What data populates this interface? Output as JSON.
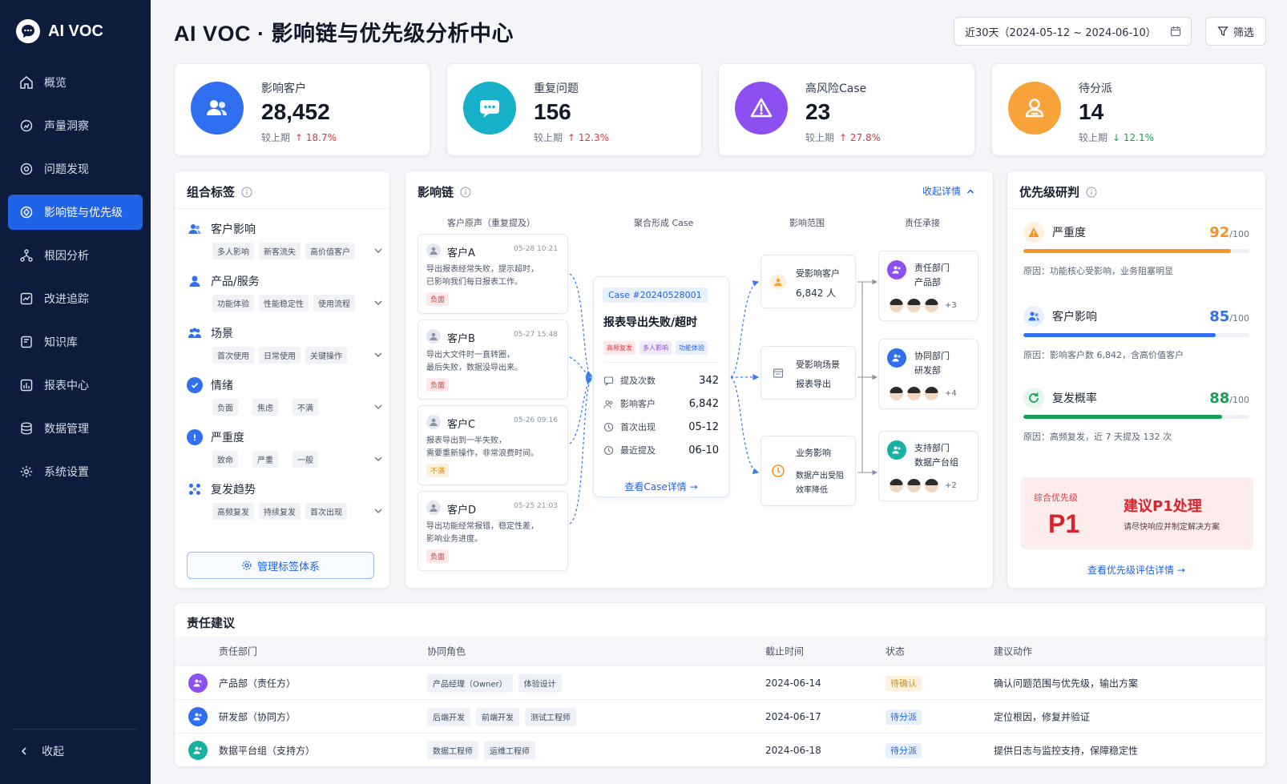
{
  "app": {
    "name": "AI VOC"
  },
  "nav": [
    {
      "label": "概览",
      "icon": "home-icon"
    },
    {
      "label": "声量洞察",
      "icon": "insight-icon"
    },
    {
      "label": "问题发现",
      "icon": "target-icon"
    },
    {
      "label": "影响链与优先级",
      "icon": "chain-icon",
      "active": true
    },
    {
      "label": "根因分析",
      "icon": "tree-icon"
    },
    {
      "label": "改进追踪",
      "icon": "track-icon"
    },
    {
      "label": "知识库",
      "icon": "book-icon"
    },
    {
      "label": "报表中心",
      "icon": "report-icon"
    },
    {
      "label": "数据管理",
      "icon": "database-icon"
    },
    {
      "label": "系统设置",
      "icon": "gear-icon"
    }
  ],
  "collapse_label": "收起",
  "page_title": "AI VOC · 影响链与优先级分析中心",
  "date_range": "近30天（2024-05-12 ~ 2024-06-10）",
  "filter_label": "筛选",
  "kpis": [
    {
      "label": "影响客户",
      "value": "28,452",
      "cmp": "较上期",
      "change": "↑ 18.7%",
      "color": "#2f6ff0"
    },
    {
      "label": "重复问题",
      "value": "156",
      "cmp": "较上期",
      "change": "↑ 12.3%",
      "color": "#16b1c8"
    },
    {
      "label": "高风险Case",
      "value": "23",
      "cmp": "较上期",
      "change": "↑ 27.8%",
      "color": "#8e4ff0"
    },
    {
      "label": "待分派",
      "value": "14",
      "cmp": "较上期",
      "change": "↓ 12.1%",
      "color": "#f7a33a"
    }
  ],
  "tags_panel": {
    "title": "组合标签",
    "groups": [
      {
        "label": "客户影响",
        "tags": [
          "多人影响",
          "新客流失",
          "高价值客户"
        ],
        "color": "#2f6ff0"
      },
      {
        "label": "产品/服务",
        "tags": [
          "功能体验",
          "性能稳定性",
          "使用流程"
        ],
        "color": "#2f6ff0"
      },
      {
        "label": "场景",
        "tags": [
          "首次使用",
          "日常使用",
          "关键操作"
        ],
        "color": "#2f6ff0"
      },
      {
        "label": "情绪",
        "tags": [
          "负面",
          "焦虑",
          "不满"
        ],
        "color": "#2f6ff0"
      },
      {
        "label": "严重度",
        "tags": [
          "致命",
          "严重",
          "一般"
        ],
        "color": "#2f6ff0"
      },
      {
        "label": "复发趋势",
        "tags": [
          "高频复发",
          "持续复发",
          "首次出现"
        ],
        "color": "#2f6ff0"
      }
    ],
    "manage_label": "管理标签体系"
  },
  "chain": {
    "title": "影响链",
    "toggle_label": "收起详情",
    "columns": [
      "客户原声（重复提及）",
      "聚合形成 Case",
      "影响范围",
      "责任承接"
    ],
    "voices": [
      {
        "name": "客户A",
        "time": "05-28 10:21",
        "line1": "导出报表经常失败，提示超时，",
        "line2": "已影响我们每日报表工作。",
        "sentiment": "负面"
      },
      {
        "name": "客户B",
        "time": "05-27 15:48",
        "line1": "导出大文件时一直转圈，",
        "line2": "最后失败，数据没导出来。",
        "sentiment": "负面"
      },
      {
        "name": "客户C",
        "time": "05-26 09:16",
        "line1": "报表导出到一半失败，",
        "line2": "需要重新操作，非常浪费时间。",
        "sentiment": "不满"
      },
      {
        "name": "客户D",
        "time": "05-25 21:03",
        "line1": "导出功能经常报错，稳定性差，",
        "line2": "影响业务进度。",
        "sentiment": "负面"
      }
    ],
    "case": {
      "id": "Case #20240528001",
      "title": "报表导出失败/超时",
      "tags": [
        "高频复发",
        "多人影响",
        "功能体验"
      ],
      "rows": [
        {
          "label": "提及次数",
          "value": "342"
        },
        {
          "label": "影响客户",
          "value": "6,842"
        },
        {
          "label": "首次出现",
          "value": "05-12"
        },
        {
          "label": "最近提及",
          "value": "06-10"
        }
      ],
      "link": "查看Case详情"
    },
    "scopes": [
      {
        "line1": "受影响客户",
        "line2": "6,842 人",
        "color": "#f7a33a"
      },
      {
        "line1": "受影响场景",
        "line2": "报表导出",
        "color": "#7a8194"
      },
      {
        "line1": "业务影响",
        "line2": "数据产出受阻",
        "line3": "效率降低",
        "color": "#f7a33a"
      }
    ],
    "resp": [
      {
        "line1": "责任部门",
        "line2": "产品部",
        "more": "+3",
        "color": "#8e4ff0"
      },
      {
        "line1": "协同部门",
        "line2": "研发部",
        "more": "+4",
        "color": "#2f6ff0"
      },
      {
        "line1": "支持部门",
        "line2": "数据产台组",
        "more": "+2",
        "color": "#16b1a0"
      }
    ]
  },
  "priority": {
    "title": "优先级研判",
    "items": [
      {
        "label": "严重度",
        "score": "92",
        "max": "/100",
        "pct": 0.92,
        "reason": "原因：功能核心受影响，业务阻塞明显",
        "color": "#f7931e"
      },
      {
        "label": "客户影响",
        "score": "85",
        "max": "/100",
        "pct": 0.85,
        "reason": "原因：影响客户数 6,842，含高价值客户",
        "color": "#2f6ff0"
      },
      {
        "label": "复发概率",
        "score": "88",
        "max": "/100",
        "pct": 0.88,
        "reason": "原因：高频复发，近 7 天提及 132 次",
        "color": "#18a058"
      }
    ],
    "overall_label": "综合优先级",
    "overall_value": "P1",
    "suggest": "建议P1处理",
    "suggest_sub": "请尽快响应并制定解决方案",
    "link": "查看优先级评估详情"
  },
  "responsibility": {
    "title": "责任建议",
    "headers": [
      "责任部门",
      "协同角色",
      "截止时间",
      "状态",
      "建议动作"
    ],
    "rows": [
      {
        "dept": "产品部（责任方）",
        "roles": [
          "产品经理（Owner）",
          "体验设计"
        ],
        "due": "2024-06-14",
        "status": "待确认",
        "status_type": "warn",
        "action": "确认问题范围与优先级，输出方案",
        "color": "#8e4ff0"
      },
      {
        "dept": "研发部（协同方）",
        "roles": [
          "后端开发",
          "前端开发",
          "测试工程师"
        ],
        "due": "2024-06-17",
        "status": "待分派",
        "status_type": "info",
        "action": "定位根因，修复并验证",
        "color": "#2f6ff0"
      },
      {
        "dept": "数据平台组（支持方）",
        "roles": [
          "数据工程师",
          "运维工程师"
        ],
        "due": "2024-06-18",
        "status": "待分派",
        "status_type": "info",
        "action": "提供日志与监控支持，保障稳定性",
        "color": "#16b1a0"
      }
    ]
  }
}
